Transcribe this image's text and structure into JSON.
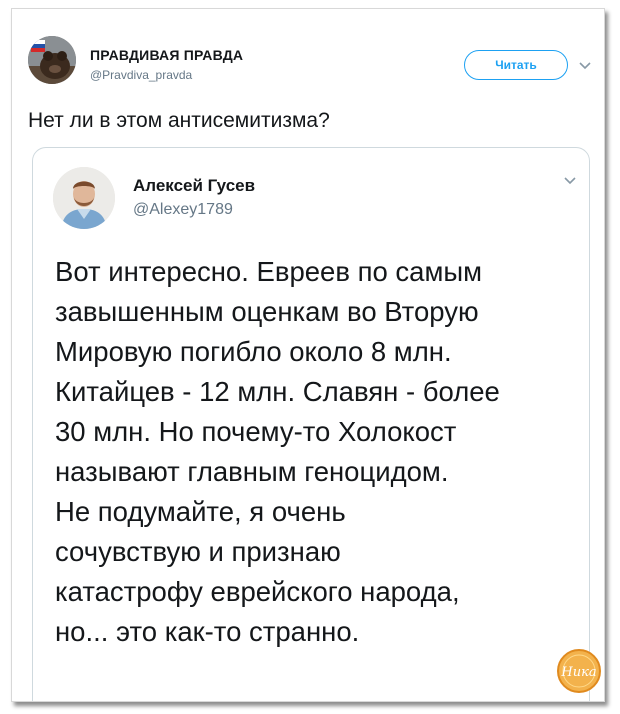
{
  "tweet": {
    "author_name": "ПРАВДИВАЯ ПРАВДА",
    "author_handle": "@Pravdiva_pravda",
    "follow_label": "Читать",
    "text": "Нет ли в этом антисемитизма?"
  },
  "quoted": {
    "author_name": "Алексей Гусев",
    "author_handle": "@Alexey1789",
    "text": "Вот интересно. Евреев по самым\nзавышенным оценкам во Вторую\nМировую погибло около 8 млн.\nКитайцев - 12 млн. Славян - более\n30 млн. Но почему-то Холокост\nназывают главным геноцидом.\nНе подумайте, я очень\nсочувствую и признаю\nкатастрофу еврейского народа,\nно... это как-то странно."
  },
  "watermark": {
    "text": "Ника",
    "color": "#e8a23a"
  },
  "colors": {
    "accent": "#1da1f2",
    "secondary_text": "#657786",
    "border": "#cfd9de"
  }
}
